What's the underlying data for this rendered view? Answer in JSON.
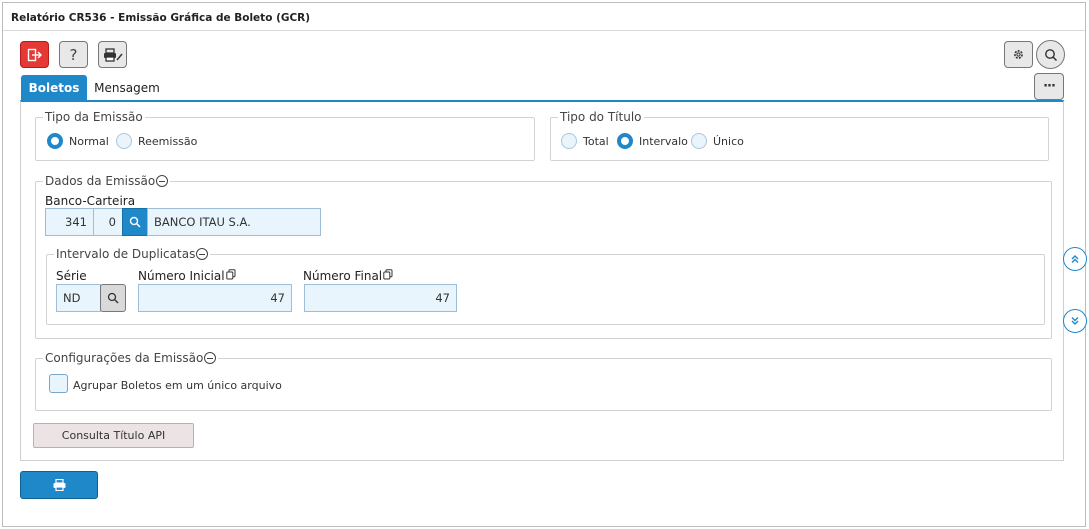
{
  "window": {
    "title": "Relatório CR536 - Emissão Gráfica de Boleto (GCR)"
  },
  "toolbar": {
    "exit_icon": "exit-icon",
    "help_glyph": "?",
    "print_icon": "print-edit-icon",
    "gear_icon": "gear-icon",
    "search_icon": "search-icon",
    "more_glyph": "···"
  },
  "tabs": [
    {
      "label": "Boletos",
      "active": true
    },
    {
      "label": "Mensagem",
      "active": false
    }
  ],
  "tipo_emissao": {
    "legend": "Tipo da Emissão",
    "options": [
      {
        "label": "Normal",
        "selected": true
      },
      {
        "label": "Reemissão",
        "selected": false
      }
    ]
  },
  "tipo_titulo": {
    "legend": "Tipo do Título",
    "options": [
      {
        "label": "Total",
        "selected": false
      },
      {
        "label": "Intervalo",
        "selected": true
      },
      {
        "label": "Único",
        "selected": false
      }
    ]
  },
  "dados_emissao": {
    "legend": "Dados da Emissão",
    "banco_carteira": {
      "label": "Banco-Carteira",
      "banco": "341",
      "carteira": "0",
      "nome": "BANCO ITAU S.A."
    },
    "intervalo": {
      "legend": "Intervalo de Duplicatas",
      "serie_label": "Série",
      "serie_value": "ND",
      "numero_inicial_label": "Número Inicial",
      "numero_inicial_value": "47",
      "numero_final_label": "Número Final",
      "numero_final_value": "47"
    }
  },
  "configuracoes": {
    "legend": "Configurações da Emissão",
    "agrupar_label": "Agrupar Boletos em um único arquivo",
    "agrupar_checked": false
  },
  "actions": {
    "consulta_label": "Consulta Título API",
    "print_icon": "print-icon"
  },
  "colors": {
    "accent": "#1e88c9",
    "exit": "#e53935"
  }
}
